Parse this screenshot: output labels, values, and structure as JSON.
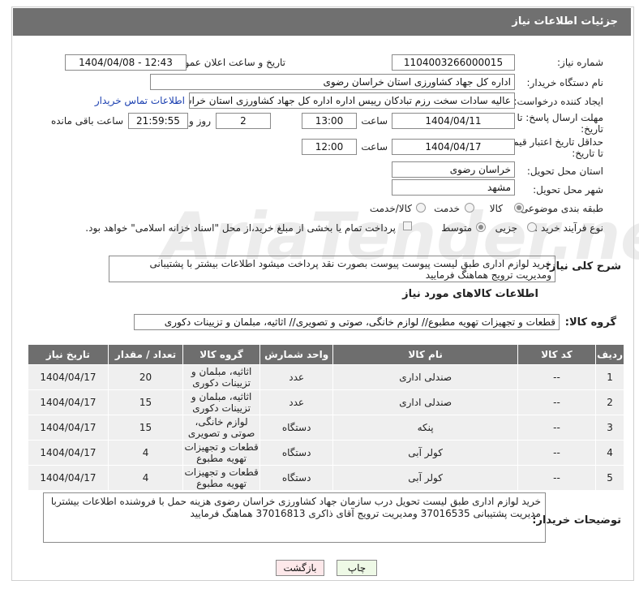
{
  "header": {
    "title": "جزئیات اطلاعات نیاز"
  },
  "form": {
    "need_number_label": "شماره نیاز:",
    "need_number": "1104003266000015",
    "announce_label": "تاریخ و ساعت اعلان عمومی:",
    "announce_value": "1404/04/08 - 12:43",
    "buyer_org_label": "نام دستگاه خریدار:",
    "buyer_org": "اداره کل جهاد کشاورزی استان خراسان رضوی",
    "creator_label": "ایجاد کننده درخواست:",
    "creator": "عالیه سادات سخت رزم تبادکان رییس اداره  اداره کل جهاد کشاورزی استان خراسان رضوی",
    "contact_link": "اطلاعات تماس خریدار",
    "deadline_label_1": "مهلت ارسال پاسخ: تا",
    "deadline_label_2": "تاریخ:",
    "deadline_date": "1404/04/11",
    "time_label": "ساعت",
    "deadline_time": "13:00",
    "days_value": "2",
    "days_label": "روز و",
    "remaining_time": "21:59:55",
    "remaining_label": "ساعت باقی مانده",
    "validity_label_1": "حداقل تاریخ اعتبار قیمت:",
    "validity_label_2": "تا تاریخ:",
    "validity_date": "1404/04/17",
    "validity_time": "12:00",
    "province_label": "استان محل تحویل:",
    "province": "خراسان رضوی",
    "city_label": "شهر محل تحویل:",
    "city": "مشهد",
    "category_label": "طبقه بندی موضوعی:",
    "category_options": [
      "کالا",
      "خدمت",
      "کالا/خدمت"
    ],
    "category_selected": "کالا",
    "process_label": "نوع فرآیند خرید :",
    "process_options": [
      "جزیی",
      "متوسط"
    ],
    "process_selected": "متوسط",
    "payment_note": "پرداخت تمام یا بخشی از مبلغ خرید،از محل \"اسناد خزانه اسلامی\" خواهد بود."
  },
  "description": {
    "label": "شرح کلی نیاز:",
    "text": "خرید لوازم اداری طبق لیست پیوست پیوست بصورت نقد پرداخت میشود اطلاعات بیشتر با پشتیبانی ومدیریت ترویج هماهنگ فرمایید"
  },
  "goods_section": {
    "title": "اطلاعات کالاهای مورد نیاز",
    "group_label": "گروه کالا:",
    "group_value": "قطعات و تجهیزات تهویه مطبوع// لوازم خانگی، صوتی و تصویری// اثاثیه، مبلمان و تزیینات دکوری"
  },
  "table": {
    "headers": [
      "ردیف",
      "کد کالا",
      "نام کالا",
      "واحد شمارش",
      "گروه کالا",
      "تعداد / مقدار",
      "تاریخ نیاز"
    ],
    "rows": [
      {
        "idx": "1",
        "code": "--",
        "name": "صندلی اداری",
        "unit": "عدد",
        "group": "اثاثیه، مبلمان و تزیینات دکوری",
        "qty": "20",
        "date": "1404/04/17"
      },
      {
        "idx": "2",
        "code": "--",
        "name": "صندلی اداری",
        "unit": "عدد",
        "group": "اثاثیه، مبلمان و تزیینات دکوری",
        "qty": "15",
        "date": "1404/04/17"
      },
      {
        "idx": "3",
        "code": "--",
        "name": "پنکه",
        "unit": "دستگاه",
        "group": "لوازم خانگی، صوتی و تصویری",
        "qty": "15",
        "date": "1404/04/17"
      },
      {
        "idx": "4",
        "code": "--",
        "name": "کولر آبی",
        "unit": "دستگاه",
        "group": "قطعات و تجهیزات تهویه مطبوع",
        "qty": "4",
        "date": "1404/04/17"
      },
      {
        "idx": "5",
        "code": "--",
        "name": "کولر آبی",
        "unit": "دستگاه",
        "group": "قطعات و تجهیزات تهویه مطبوع",
        "qty": "4",
        "date": "1404/04/17"
      }
    ]
  },
  "buyer_notes": {
    "label": "توضیحات خریدار:",
    "text": "خرید لوازم اداری طبق لیست تحویل درب سازمان جهاد کشاورزی خراسان رضوی هزینه حمل با فروشنده اطلاعات بیشتربا مدیریت پشتیبانی 37016535 ومدیریت ترویج آقای ذاکری 37016813 هماهنگ فرمایید"
  },
  "buttons": {
    "print": "چاپ",
    "back": "بازگشت"
  },
  "watermark": "AriaTender.neT"
}
